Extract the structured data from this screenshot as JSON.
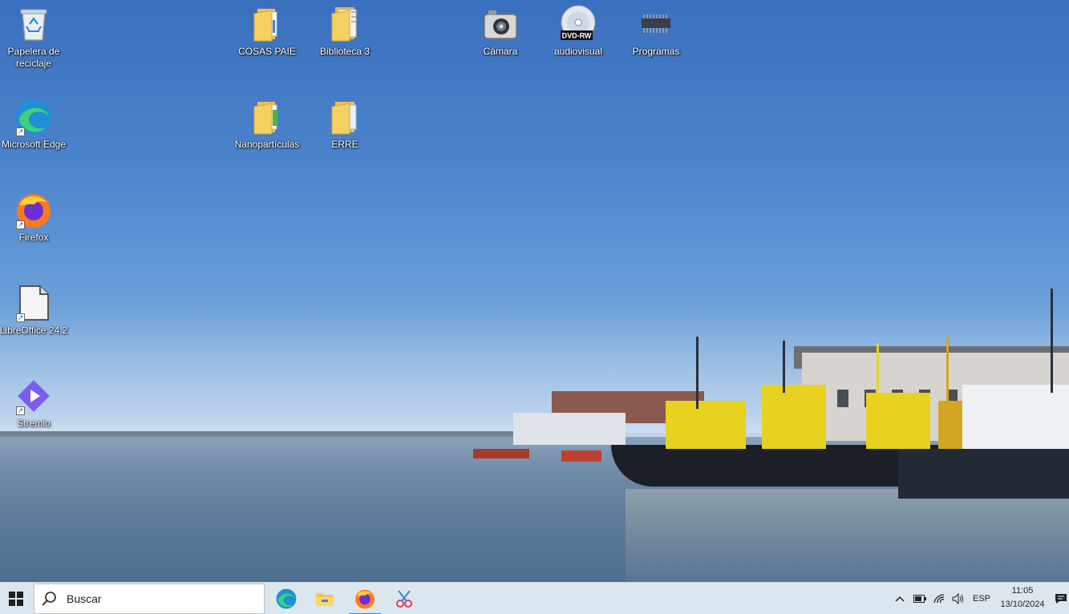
{
  "desktop": {
    "icons": [
      {
        "label": "Papelera de reciclaje",
        "icon": "recycle-bin-icon"
      },
      {
        "label": "Microsoft Edge",
        "icon": "edge-icon"
      },
      {
        "label": "Firefox",
        "icon": "firefox-icon"
      },
      {
        "label": "LibreOffice 24.2",
        "icon": "libreoffice-icon"
      },
      {
        "label": "Stremio",
        "icon": "stremio-icon"
      },
      {
        "label": "COSAS PAIE",
        "icon": "folder-icon"
      },
      {
        "label": "Nanopartículas",
        "icon": "folder-icon"
      },
      {
        "label": "Biblioteca 3",
        "icon": "folder-icon"
      },
      {
        "label": "ERRE",
        "icon": "folder-icon"
      },
      {
        "label": "Cámara",
        "icon": "camera-icon"
      },
      {
        "label": "audiovisual",
        "icon": "dvd-rw-drive-icon",
        "badge": "DVD-RW"
      },
      {
        "label": "Programas",
        "icon": "memory-chip-icon"
      }
    ]
  },
  "taskbar": {
    "search_placeholder": "Buscar",
    "pinned": [
      "edge-icon",
      "file-explorer-icon",
      "firefox-icon",
      "snipping-tool-icon"
    ],
    "tray": {
      "language": "ESP",
      "time": "11:05",
      "date": "13/10/2024"
    }
  },
  "colors": {
    "taskbar_bg": "#dce6ee",
    "accent": "#3a86d8",
    "folder": "#f3c64a"
  }
}
